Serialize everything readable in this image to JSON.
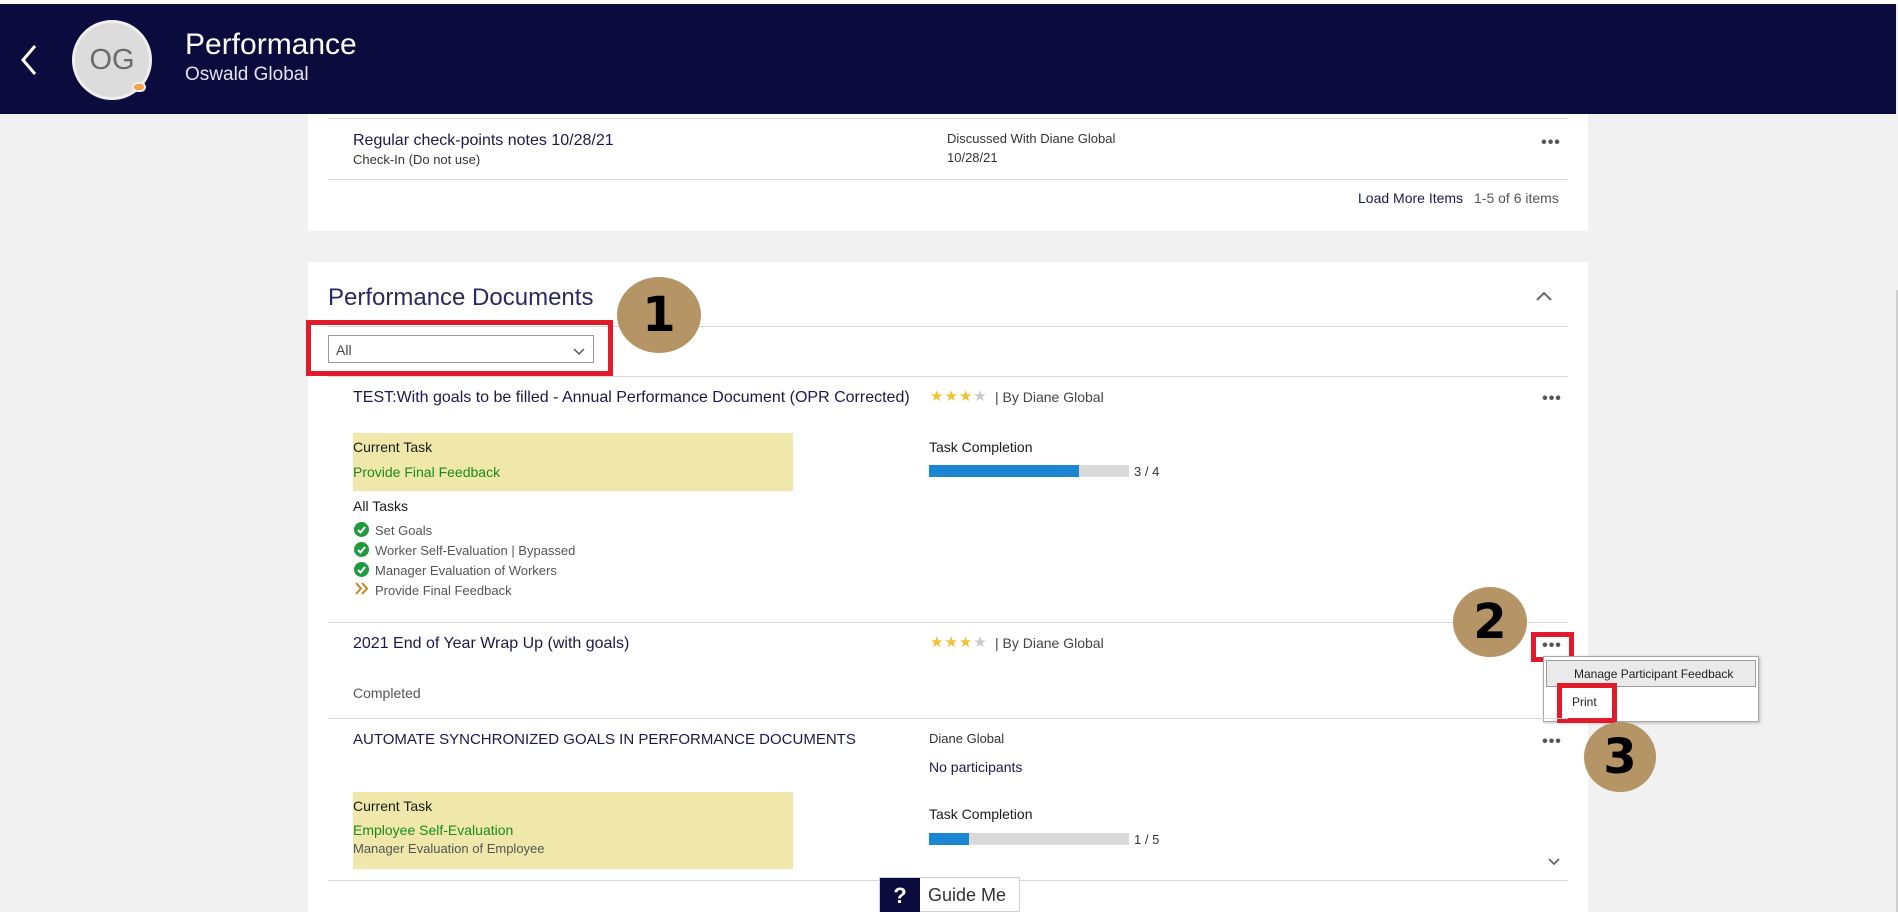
{
  "header": {
    "title": "Performance",
    "subtitle": "Oswald Global",
    "avatar_initials": "OG",
    "background_color": "#0b0c3d"
  },
  "checkins": {
    "item": {
      "title": "Regular check-points notes 10/28/21",
      "type": "Check-In (Do not use)",
      "discussed_with": "Discussed With Diane Global",
      "date": "10/28/21"
    },
    "load_more": "Load More Items",
    "count": "1-5 of 6 items"
  },
  "documents": {
    "section_title": "Performance Documents",
    "filter_value": "All",
    "items": [
      {
        "title": "TEST:With goals to be filled - Annual Performance Document (OPR Corrected)",
        "rating": 3,
        "rating_max": 4,
        "by": "| By Diane Global",
        "current_task_label": "Current Task",
        "current_task": "Provide Final Feedback",
        "task_completion_label": "Task Completion",
        "progress_text": "3 / 4",
        "progress_fraction": 0.75,
        "all_tasks_label": "All Tasks",
        "tasks": [
          {
            "label": "Set Goals",
            "status": "done"
          },
          {
            "label": "Worker Self-Evaluation | Bypassed",
            "status": "done"
          },
          {
            "label": "Manager Evaluation of Workers",
            "status": "done"
          },
          {
            "label": "Provide Final Feedback",
            "status": "current"
          }
        ]
      },
      {
        "title": "2021 End of Year Wrap Up (with goals)",
        "rating": 3,
        "rating_max": 4,
        "by": "| By Diane Global",
        "status": "Completed"
      },
      {
        "title": "AUTOMATE SYNCHRONIZED GOALS IN PERFORMANCE DOCUMENTS",
        "owner": "Diane Global",
        "participants": "No participants",
        "current_task_label": "Current Task",
        "current_task": "Employee Self-Evaluation",
        "current_task_secondary": "Manager Evaluation of Employee",
        "task_completion_label": "Task Completion",
        "progress_text": "1 / 5",
        "progress_fraction": 0.2
      }
    ]
  },
  "context_menu": {
    "items": [
      "Manage Participant Feedback",
      "Print"
    ]
  },
  "callouts": [
    "1",
    "2",
    "3"
  ],
  "guide_me": {
    "icon": "?",
    "label": "Guide Me"
  },
  "colors": {
    "highlight_red": "#e21b2a",
    "badge": "#b59465",
    "task_bg": "#efe8aa",
    "progress": "#1b87d2",
    "green": "#1c8a1c"
  }
}
